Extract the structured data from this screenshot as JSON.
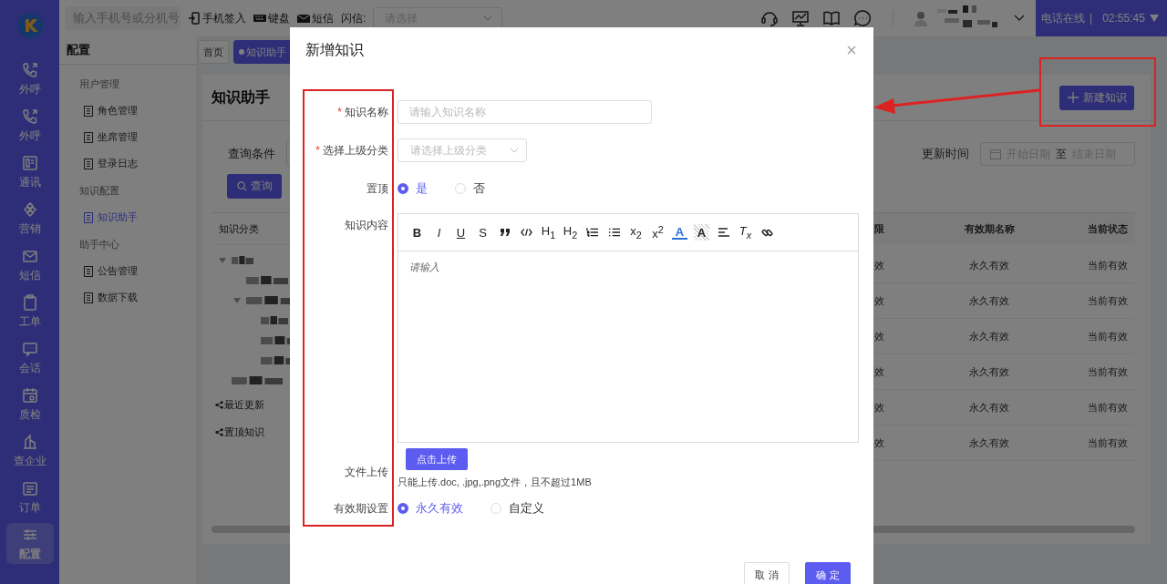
{
  "nav_rail": {
    "items": [
      {
        "label": "外呼",
        "selected": false
      },
      {
        "label": "外呼",
        "selected": false
      },
      {
        "label": "通讯",
        "selected": false
      },
      {
        "label": "营销",
        "selected": false
      },
      {
        "label": "短信",
        "selected": false
      },
      {
        "label": "工单",
        "selected": false
      },
      {
        "label": "会话",
        "selected": false
      },
      {
        "label": "质检",
        "selected": false
      },
      {
        "label": "查企业",
        "selected": false
      },
      {
        "label": "订单",
        "selected": false
      },
      {
        "label": "配置",
        "selected": true
      }
    ]
  },
  "top_bar": {
    "search": {
      "placeholder": "输入手机号或分机号"
    },
    "actions": [
      "手机签入",
      "键盘",
      "短信"
    ],
    "flash_label": "闪信:",
    "flash_select": {
      "placeholder": "请选择"
    },
    "status": "电话在线",
    "separator": "|",
    "clock": "02:55:45"
  },
  "submenu": {
    "title": "配置",
    "groups": [
      {
        "label": "用户管理",
        "items": [
          {
            "label": "角色管理",
            "selected": false
          },
          {
            "label": "坐席管理",
            "selected": false
          },
          {
            "label": "登录日志",
            "selected": false
          }
        ]
      },
      {
        "label": "知识配置",
        "items": [
          {
            "label": "知识助手",
            "selected": true
          }
        ]
      },
      {
        "label": "助手中心",
        "items": [
          {
            "label": "公告管理",
            "selected": false
          },
          {
            "label": "数据下载",
            "selected": false
          }
        ]
      }
    ]
  },
  "tabs": [
    {
      "label": "首页",
      "selected": false
    },
    {
      "label": "知识助手",
      "selected": true
    }
  ],
  "page": {
    "title": "知识助手",
    "new_button": "新建知识",
    "query_label": "查询条件",
    "time_label": "更新时间",
    "start_placeholder": "开始日期",
    "range_separator": "至",
    "end_placeholder": "结束日期",
    "query_button": "查询"
  },
  "tree": {
    "header": "知识分类",
    "nodes": [
      {
        "kind": "branch",
        "expanded": true,
        "children": [
          {
            "kind": "leaf"
          },
          {
            "kind": "branch",
            "expanded": true,
            "children": [
              {
                "kind": "leaf"
              },
              {
                "kind": "leaf"
              },
              {
                "kind": "leaf"
              }
            ]
          }
        ]
      },
      {
        "kind": "leaf"
      }
    ]
  },
  "quick_links": [
    "最近更新",
    "置顶知识"
  ],
  "table": {
    "columns": [
      "限",
      "有效期名称",
      "当前状态"
    ],
    "rows": [
      [
        "效",
        "永久有效",
        "当前有效"
      ],
      [
        "效",
        "永久有效",
        "当前有效"
      ],
      [
        "效",
        "永久有效",
        "当前有效"
      ],
      [
        "效",
        "永久有效",
        "当前有效"
      ],
      [
        "效",
        "永久有效",
        "当前有效"
      ],
      [
        "效",
        "永久有效",
        "当前有效"
      ]
    ]
  },
  "modal": {
    "title": "新增知识",
    "fields": [
      {
        "kind": "text",
        "marker": "*",
        "label": "知识名称",
        "placeholder": "请输入知识名称"
      },
      {
        "kind": "select",
        "marker": "*",
        "label": "选择上级分类",
        "placeholder": "请选择上级分类"
      },
      {
        "kind": "radio",
        "label": "置顶",
        "options": [
          {
            "label": "是",
            "selected": true
          },
          {
            "label": "否",
            "selected": false
          }
        ]
      },
      {
        "kind": "editor",
        "label": "知识内容",
        "placeholder": "请输入",
        "toolbar": [
          {
            "kind": "bold",
            "text": "B"
          },
          {
            "kind": "italic",
            "text": "I"
          },
          {
            "kind": "underline",
            "text": "U"
          },
          {
            "kind": "strike",
            "text": "S"
          },
          {
            "kind": "quote"
          },
          {
            "kind": "code"
          },
          {
            "kind": "heading",
            "text": "H$_{1}$"
          },
          {
            "kind": "heading",
            "text": "H$_{2}$"
          },
          {
            "kind": "ordered"
          },
          {
            "kind": "bullet"
          },
          {
            "kind": "script",
            "text": "x$_{2}$"
          },
          {
            "kind": "script",
            "text": "x$^{2}$"
          },
          {
            "kind": "color",
            "text": "A"
          },
          {
            "kind": "background",
            "text": "A"
          },
          {
            "kind": "align"
          },
          {
            "kind": "clear",
            "text": "T$_{x}$"
          },
          {
            "kind": "link"
          }
        ]
      },
      {
        "kind": "upload",
        "label": "文件上传",
        "button": "点击上传",
        "hint": "只能上传.doc, .jpg,.png文件，且不超过1MB"
      },
      {
        "kind": "radio",
        "label": "有效期设置",
        "options": [
          {
            "label": "永久有效",
            "selected": true
          },
          {
            "label": "自定义",
            "selected": false
          }
        ]
      }
    ],
    "cancel": "取 消",
    "ok": "确 定"
  }
}
